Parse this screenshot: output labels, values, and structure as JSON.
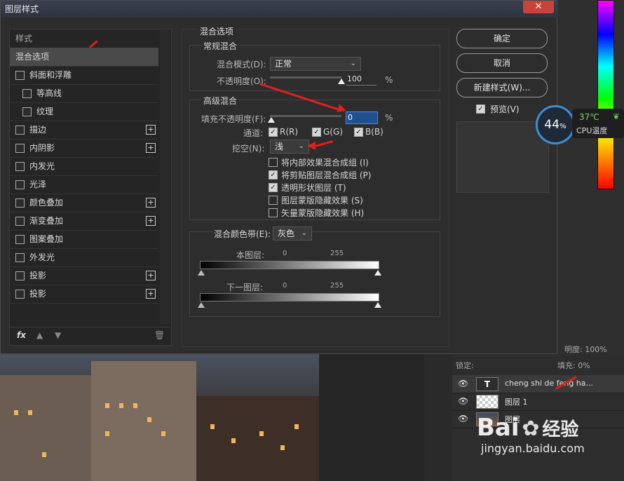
{
  "dialog": {
    "title": "图层样式",
    "close_icon": "close-icon"
  },
  "stylelist": {
    "header": "样式",
    "items": [
      {
        "label": "混合选项",
        "checkbox": false,
        "plus": false,
        "selected": true,
        "indent": 0
      },
      {
        "label": "斜面和浮雕",
        "checkbox": true,
        "plus": false,
        "indent": 0
      },
      {
        "label": "等高线",
        "checkbox": true,
        "plus": false,
        "indent": 1
      },
      {
        "label": "纹理",
        "checkbox": true,
        "plus": false,
        "indent": 1
      },
      {
        "label": "描边",
        "checkbox": true,
        "plus": true,
        "indent": 0
      },
      {
        "label": "内阴影",
        "checkbox": true,
        "plus": true,
        "indent": 0
      },
      {
        "label": "内发光",
        "checkbox": true,
        "plus": false,
        "indent": 0
      },
      {
        "label": "光泽",
        "checkbox": true,
        "plus": false,
        "indent": 0
      },
      {
        "label": "颜色叠加",
        "checkbox": true,
        "plus": true,
        "indent": 0
      },
      {
        "label": "渐变叠加",
        "checkbox": true,
        "plus": true,
        "indent": 0
      },
      {
        "label": "图案叠加",
        "checkbox": true,
        "plus": false,
        "indent": 0
      },
      {
        "label": "外发光",
        "checkbox": true,
        "plus": false,
        "indent": 0
      },
      {
        "label": "投影",
        "checkbox": true,
        "plus": true,
        "indent": 0
      },
      {
        "label": "投影",
        "checkbox": true,
        "plus": true,
        "indent": 0
      }
    ],
    "footer_fx": "fx"
  },
  "blend": {
    "section_title": "混合选项",
    "general_title": "常规混合",
    "mode_label": "混合模式(D):",
    "mode_value": "正常",
    "opacity_label": "不透明度(O):",
    "opacity_value": "100",
    "percent": "%",
    "advanced_title": "高级混合",
    "fill_label": "填充不透明度(F):",
    "fill_value": "0",
    "channels_label": "通道:",
    "channel_r": "R(R)",
    "channel_g": "G(G)",
    "channel_b": "B(B)",
    "knockout_label": "挖空(N):",
    "knockout_value": "浅",
    "options": [
      {
        "label": "将内部效果混合成组 (I)",
        "checked": false
      },
      {
        "label": "将剪贴图层混合成组 (P)",
        "checked": true
      },
      {
        "label": "透明形状图层 (T)",
        "checked": true
      },
      {
        "label": "图层蒙版隐藏效果 (S)",
        "checked": false
      },
      {
        "label": "矢量蒙版隐藏效果 (H)",
        "checked": false
      }
    ],
    "blend_if_label": "混合颜色带(E):",
    "blend_if_value": "灰色",
    "this_layer": "本图层:",
    "under_layer": "下一图层:",
    "tick_min": "0",
    "tick_max": "255"
  },
  "buttons": {
    "ok": "确定",
    "cancel": "取消",
    "new_style": "新建样式(W)...",
    "preview": "预览(V)"
  },
  "cpu": {
    "percent": "44",
    "percent_sign": "%",
    "temp": "37℃",
    "label": "CPU温度"
  },
  "layers_panel": {
    "opacity_text": "明度: 100%",
    "lock_label": "锁定:",
    "fill_text": "填充: 0%",
    "layers": [
      {
        "name": "cheng shi de feng ha...",
        "type": "text"
      },
      {
        "name": "图层 1",
        "type": "transparent"
      },
      {
        "name": "图层",
        "type": "photo"
      }
    ]
  },
  "watermark": {
    "brand": "Bai",
    "brand2": "经验",
    "url": "jingyan.baidu.com"
  }
}
